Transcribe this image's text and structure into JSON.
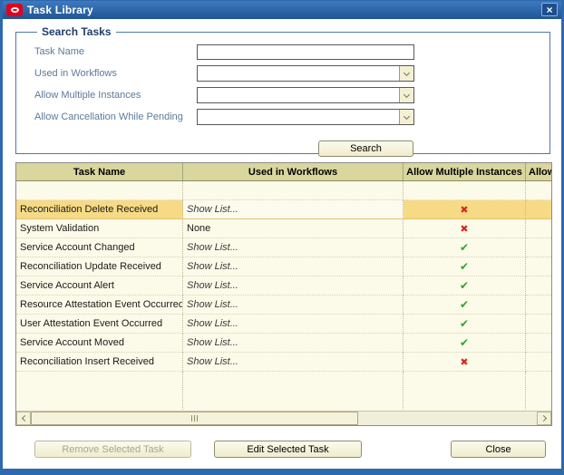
{
  "window": {
    "title": "Task Library"
  },
  "icons": {
    "close": "×",
    "check": "✔",
    "cross": "✖"
  },
  "colors": {
    "titlebar": "#2E69AE",
    "window_border": "#2E69AE",
    "oracle_red": "#E3001B",
    "fieldset_border": "#4D79A8",
    "label_text": "#5C7A99",
    "table_bg": "#FCFAE8",
    "header_bg": "#D9D69E",
    "selected_row": "#F7DA85",
    "check_green": "#2BA52B",
    "cross_red": "#D42A22"
  },
  "search": {
    "legend": "Search Tasks",
    "button_label": "Search",
    "fields": [
      {
        "label": "Task Name",
        "type": "text",
        "value": ""
      },
      {
        "label": "Used in Workflows",
        "type": "select",
        "value": ""
      },
      {
        "label": "Allow Multiple Instances",
        "type": "select",
        "value": ""
      },
      {
        "label": "Allow Cancellation While Pending",
        "type": "select",
        "value": ""
      }
    ]
  },
  "table": {
    "columns": [
      "Task Name",
      "Used in Workflows",
      "Allow Multiple Instances",
      "Allow Cancellation While Pending"
    ],
    "rows": [
      {
        "task_name": "",
        "workflows": "",
        "multiple": "",
        "selected": false
      },
      {
        "task_name": "Reconciliation Delete Received",
        "workflows": "Show List...",
        "multiple": "no",
        "selected": true
      },
      {
        "task_name": "System Validation",
        "workflows": "None",
        "multiple": "no",
        "selected": false
      },
      {
        "task_name": "Service Account Changed",
        "workflows": "Show List...",
        "multiple": "yes",
        "selected": false
      },
      {
        "task_name": "Reconciliation Update Received",
        "workflows": "Show List...",
        "multiple": "yes",
        "selected": false
      },
      {
        "task_name": "Service Account Alert",
        "workflows": "Show List...",
        "multiple": "yes",
        "selected": false
      },
      {
        "task_name": "Resource Attestation Event Occurred",
        "workflows": "Show List...",
        "multiple": "yes",
        "selected": false
      },
      {
        "task_name": "User Attestation Event Occurred",
        "workflows": "Show List...",
        "multiple": "yes",
        "selected": false
      },
      {
        "task_name": "Service Account Moved",
        "workflows": "Show List...",
        "multiple": "yes",
        "selected": false
      },
      {
        "task_name": "Reconciliation Insert Received",
        "workflows": "Show List...",
        "multiple": "no",
        "selected": false
      }
    ]
  },
  "footer": {
    "buttons": [
      {
        "label": "Remove Selected Task",
        "disabled": true
      },
      {
        "label": "Edit Selected Task",
        "disabled": false
      },
      {
        "label": "Close",
        "disabled": false
      }
    ]
  }
}
